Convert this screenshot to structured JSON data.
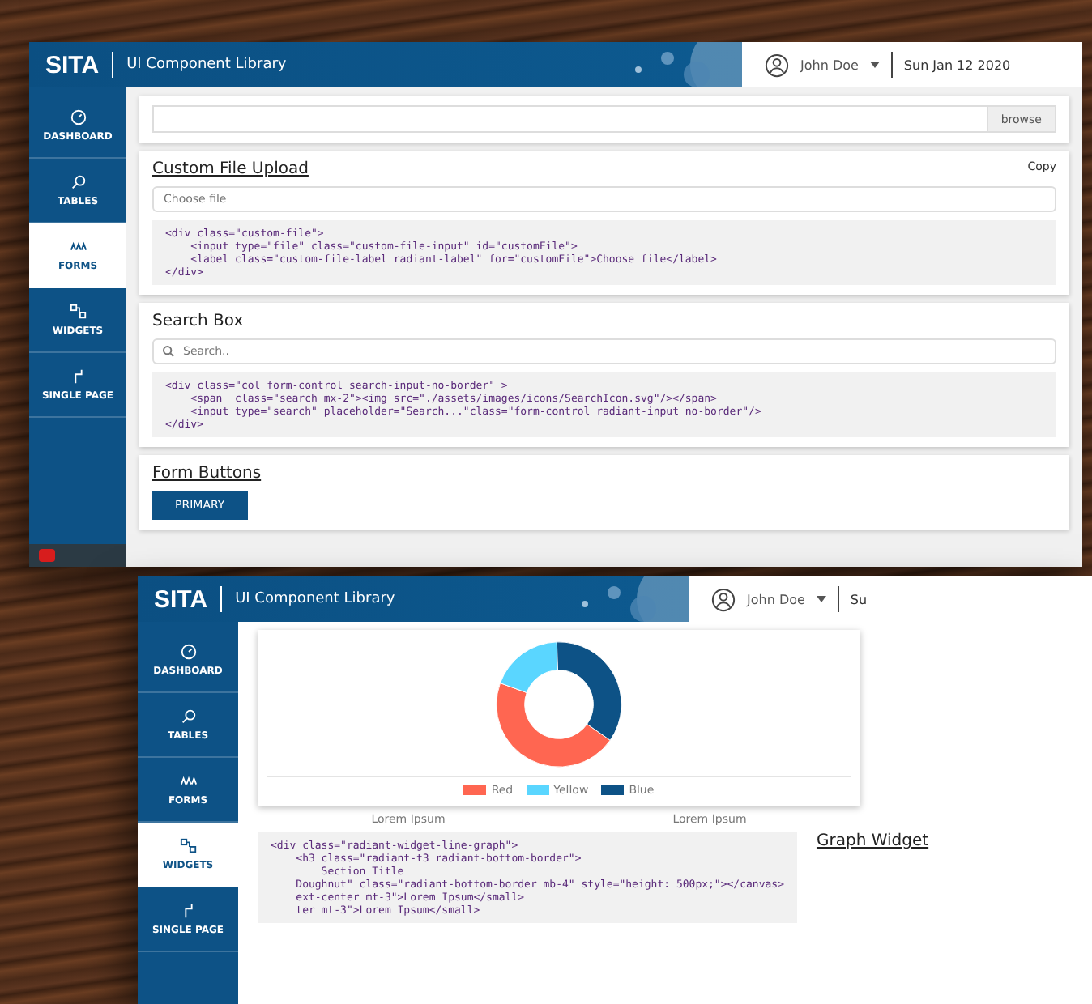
{
  "back_screen": {
    "header": {
      "logo": "SITA",
      "title": "UI Component Library",
      "user": "John Doe",
      "date": "Sun Jan 12 2020"
    },
    "sidebar": {
      "items": [
        {
          "label": "DASHBOARD",
          "kind": "dashboard",
          "selected": false
        },
        {
          "label": "TABLES",
          "kind": "tables",
          "selected": false
        },
        {
          "label": "FORMS",
          "kind": "forms",
          "selected": true
        },
        {
          "label": "WIDGETS",
          "kind": "widgets",
          "selected": false
        },
        {
          "label": "SINGLE PAGE",
          "kind": "single-page",
          "selected": false
        }
      ]
    },
    "file_card": {
      "button": "browse"
    },
    "sections": [
      {
        "kind": "file",
        "title": "Custom File Upload",
        "underlined": true,
        "copy": "Copy",
        "field": {
          "placeholder": "Choose file"
        },
        "code": [
          "<div class=\"custom-file\">",
          "    <input type=\"file\" class=\"custom-file-input\" id=\"customFile\">",
          "    <label class=\"custom-file-label radiant-label\" for=\"customFile\">Choose file</label>",
          "</div>"
        ]
      },
      {
        "kind": "search",
        "title": "Search Box",
        "underlined": false,
        "field": {
          "placeholder": "Search.."
        },
        "code": [
          "<div class=\"col form-control search-input-no-border\" >",
          "    <span  class=\"search mx-2\"><img src=\"./assets/images/icons/SearchIcon.svg\"/></span>",
          "    <input type=\"search\" placeholder=\"Search...\"class=\"form-control radiant-input no-border\"/>",
          "</div>"
        ]
      },
      {
        "kind": "buttons",
        "title": "Form Buttons",
        "underlined": true,
        "button": "PRIMARY"
      }
    ]
  },
  "front_screen": {
    "header": {
      "logo": "SITA",
      "title": "UI Component Library",
      "user": "John Doe",
      "date": "Su"
    },
    "sidebar": {
      "items": [
        {
          "label": "DASHBOARD",
          "kind": "dashboard",
          "selected": false
        },
        {
          "label": "TABLES",
          "kind": "tables",
          "selected": false
        },
        {
          "label": "FORMS",
          "kind": "forms",
          "selected": false
        },
        {
          "label": "WIDGETS",
          "kind": "widgets",
          "selected": true
        },
        {
          "label": "SINGLE PAGE",
          "kind": "single-page",
          "selected": false
        }
      ]
    },
    "chart": {
      "legend": [
        {
          "label": "Red",
          "color": "#ff6651"
        },
        {
          "label": "Yellow",
          "color": "#5ad6ff"
        },
        {
          "label": "Blue",
          "color": "#0d5286"
        }
      ],
      "captions": [
        "Lorem Ipsum",
        "Lorem Ipsum"
      ]
    },
    "code": [
      "<div class=\"radiant-widget-line-graph\">",
      "    <h3 class=\"radiant-t3 radiant-bottom-border\">",
      "        Section Title",
      "    Doughnut\" class=\"radiant-bottom-border mb-4\" style=\"height: 500px;\"></canvas>",
      "    ext-center mt-3\">Lorem Ipsum</small>",
      "    ter mt-3\">Lorem Ipsum</small>"
    ],
    "heading": "Graph Widget"
  }
}
